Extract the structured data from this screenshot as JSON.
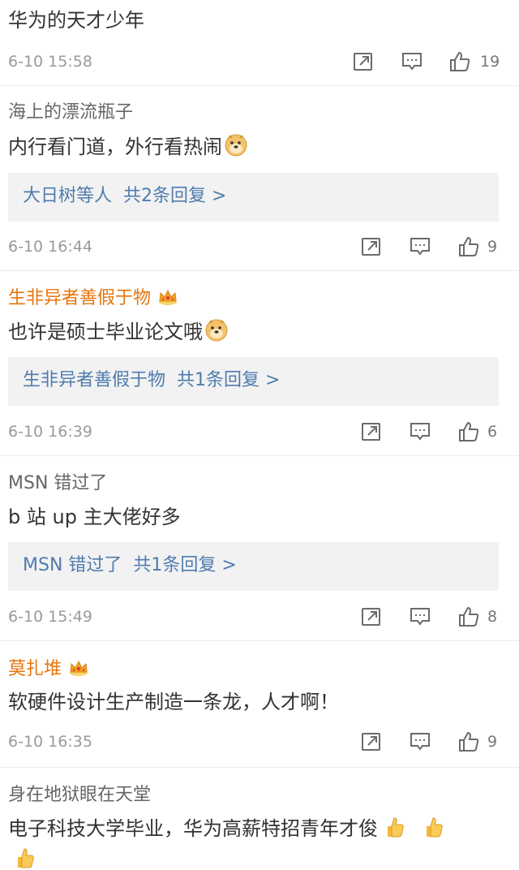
{
  "comments": [
    {
      "username": "",
      "text": "华为的天才少年",
      "time": "6-10 15:58",
      "likes": "19",
      "reply": null
    },
    {
      "username": "海上的漂流瓶子",
      "text": "内行看门道，外行看热闹",
      "emoji": "doge-emoji",
      "time": "6-10 16:44",
      "likes": "9",
      "reply": {
        "who": "大日树等人",
        "summary": "共2条回复 >"
      }
    },
    {
      "username": "生非异者善假于物",
      "vip": true,
      "text": "也许是硕士毕业论文哦",
      "emoji": "doge-emoji",
      "time": "6-10 16:39",
      "likes": "6",
      "reply": {
        "who": "生非异者善假于物",
        "summary": "共1条回复 >"
      }
    },
    {
      "username": "MSN 错过了",
      "text": "b 站 up 主大佬好多",
      "time": "6-10 15:49",
      "likes": "8",
      "reply": {
        "who": "MSN 错过了",
        "summary": "共1条回复 >"
      }
    },
    {
      "username": "莫扎堆",
      "vip": true,
      "text": "软硬件设计生产制造一条龙，人才啊！",
      "time": "6-10 16:35",
      "likes": "9",
      "reply": null
    },
    {
      "username": "身在地狱眼在天堂",
      "text": "电子科技大学毕业，华为高薪特招青年才俊",
      "emoji": "thumbs-up-emoji",
      "time": "",
      "likes": "",
      "reply": null
    }
  ],
  "colors": {
    "vip_name": "#e8740c",
    "reply_link": "#4f7cae",
    "reply_bg": "#f2f2f2",
    "meta": "#9a9a9a"
  },
  "icons": [
    "repost-icon",
    "comment-icon",
    "like-icon",
    "crown-icon",
    "doge-emoji",
    "thumbs-up-emoji"
  ]
}
